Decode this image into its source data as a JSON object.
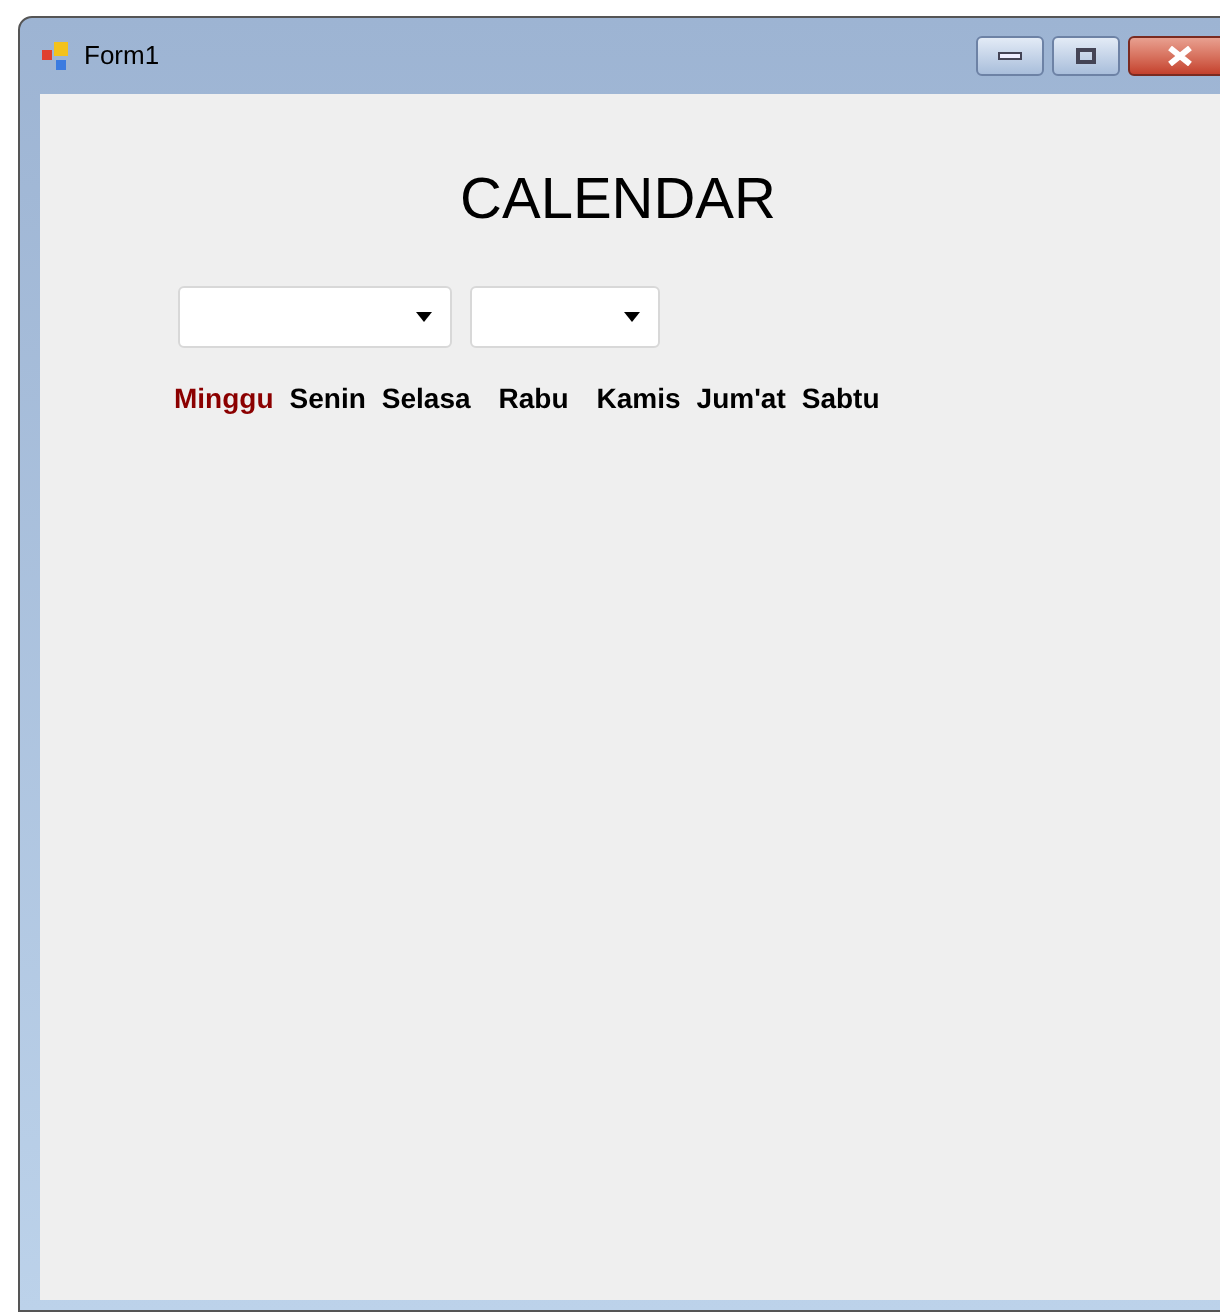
{
  "window": {
    "title": "Form1"
  },
  "heading": "CALENDAR",
  "dropdowns": [
    {
      "kind": "month"
    },
    {
      "kind": "year"
    }
  ],
  "days": [
    {
      "label": "Minggu",
      "color": "#8b0000"
    },
    {
      "label": "Senin",
      "color": "#000000"
    },
    {
      "label": "Selasa",
      "color": "#000000"
    },
    {
      "label": "Rabu",
      "color": "#000000"
    },
    {
      "label": "Kamis",
      "color": "#000000"
    },
    {
      "label": "Jum'at",
      "color": "#000000"
    },
    {
      "label": "Sabtu",
      "color": "#000000"
    }
  ]
}
